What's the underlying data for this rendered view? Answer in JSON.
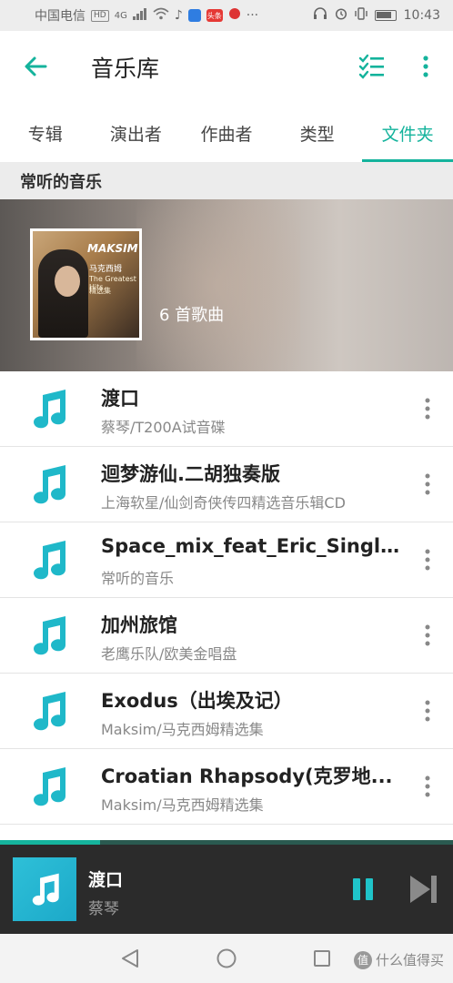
{
  "status_bar": {
    "carrier": "中国电信",
    "hd": "HD",
    "signal": "4G",
    "time": "10:43",
    "app_badge": "头条"
  },
  "app_bar": {
    "title": "音乐库"
  },
  "tabs": [
    {
      "label": "专辑",
      "active": false
    },
    {
      "label": "演出者",
      "active": false
    },
    {
      "label": "作曲者",
      "active": false
    },
    {
      "label": "类型",
      "active": false
    },
    {
      "label": "文件夹",
      "active": true
    }
  ],
  "section": {
    "title": "常听的音乐",
    "song_count": "6 首歌曲",
    "album_art_text": {
      "artist": "MAKSIM",
      "title_cn": "马克西姆",
      "subtitle": "The Greatest Hits",
      "subtitle_cn": "精选集"
    }
  },
  "songs": [
    {
      "title": "渡口",
      "subtitle": "蔡琴/T200A试音碟"
    },
    {
      "title": "迴梦游仙.二胡独奏版",
      "subtitle": "上海软星/仙剑奇侠传四精选音乐辑CD"
    },
    {
      "title": "Space_mix_feat_Eric_Singl...",
      "subtitle": "常听的音乐"
    },
    {
      "title": "加州旅馆",
      "subtitle": "老鹰乐队/欧美金唱盘"
    },
    {
      "title": "Exodus（出埃及记）",
      "subtitle": "Maksim/马克西姆精选集"
    },
    {
      "title": "Croatian Rhapsody(克罗地...",
      "subtitle": "Maksim/马克西姆精选集"
    }
  ],
  "player": {
    "title": "渡口",
    "artist": "蔡琴",
    "progress": 0.22
  },
  "watermark": "什么值得买",
  "colors": {
    "accent": "#14b39c",
    "icon": "#1fb8c9",
    "player_bg": "#2b2b2b"
  }
}
